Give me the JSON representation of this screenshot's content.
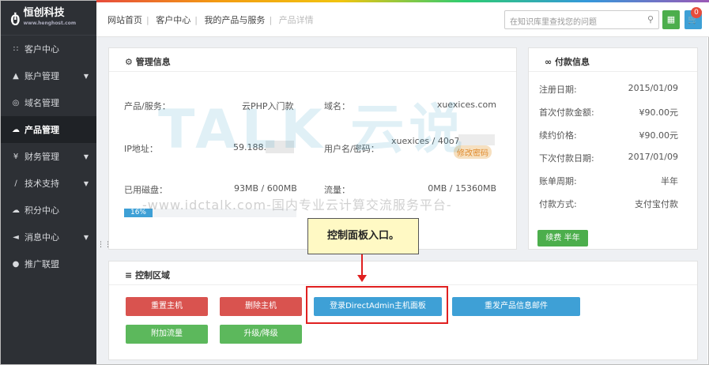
{
  "logo": {
    "name": "恒创科技",
    "sub": "www.henghost.com"
  },
  "sidebar": {
    "items": [
      {
        "label": "客户中心",
        "icon": "grid-icon",
        "caret": false,
        "active": false
      },
      {
        "label": "账户管理",
        "icon": "user-icon",
        "caret": true,
        "active": false
      },
      {
        "label": "域名管理",
        "icon": "globe-icon",
        "caret": false,
        "active": false
      },
      {
        "label": "产品管理",
        "icon": "cloud-icon",
        "caret": false,
        "active": true
      },
      {
        "label": "财务管理",
        "icon": "yen-icon",
        "caret": true,
        "active": false
      },
      {
        "label": "技术支持",
        "icon": "wrench-icon",
        "caret": true,
        "active": false
      },
      {
        "label": "积分中心",
        "icon": "cloud-icon",
        "caret": false,
        "active": false
      },
      {
        "label": "消息中心",
        "icon": "megaphone-icon",
        "caret": true,
        "active": false
      },
      {
        "label": "推广联盟",
        "icon": "info-icon",
        "caret": false,
        "active": false
      }
    ]
  },
  "topbar": {
    "crumbs": [
      "网站首页",
      "客户中心",
      "我的产品与服务",
      "产品详情"
    ],
    "search_placeholder": "在知识库里查找您的问题",
    "cart_count": "0"
  },
  "management": {
    "title": "管理信息",
    "product_label": "产品/服务：",
    "product_value": "云PHP入门款",
    "domain_label": "域名：",
    "domain_value": "xuexices.com",
    "ip_label": "IP地址：",
    "ip_value": "59.188.",
    "user_label": "用户名/密码：",
    "user_value": "xuexices / 40o7",
    "change_pwd": "修改密码",
    "disk_label": "已用磁盘：",
    "disk_value": "93MB / 600MB",
    "traffic_label": "流量：",
    "traffic_value": "0MB / 15360MB",
    "disk_percent": "16%"
  },
  "payment": {
    "title": "付款信息",
    "rows": [
      {
        "label": "注册日期:",
        "value": "2015/01/09"
      },
      {
        "label": "首次付款金额:",
        "value": "¥90.00元"
      },
      {
        "label": "续约价格:",
        "value": "¥90.00元"
      },
      {
        "label": "下次付款日期:",
        "value": "2017/01/09"
      },
      {
        "label": "账单周期:",
        "value": "半年"
      },
      {
        "label": "付款方式:",
        "value": "支付宝付款"
      }
    ],
    "renew_label": "续费 半年"
  },
  "control": {
    "title": "控制区域",
    "reboot": "重置主机",
    "delete": "删除主机",
    "login_da": "登录DirectAdmin主机面板",
    "resend": "重发产品信息邮件",
    "add_traffic": "附加流量",
    "upgrade": "升级/降级"
  },
  "annotation": {
    "callout": "控制面板入口。"
  },
  "watermark": {
    "brand": "TALK 云说",
    "url": "-www.idctalk.com-国内专业云计算交流服务平台-"
  }
}
